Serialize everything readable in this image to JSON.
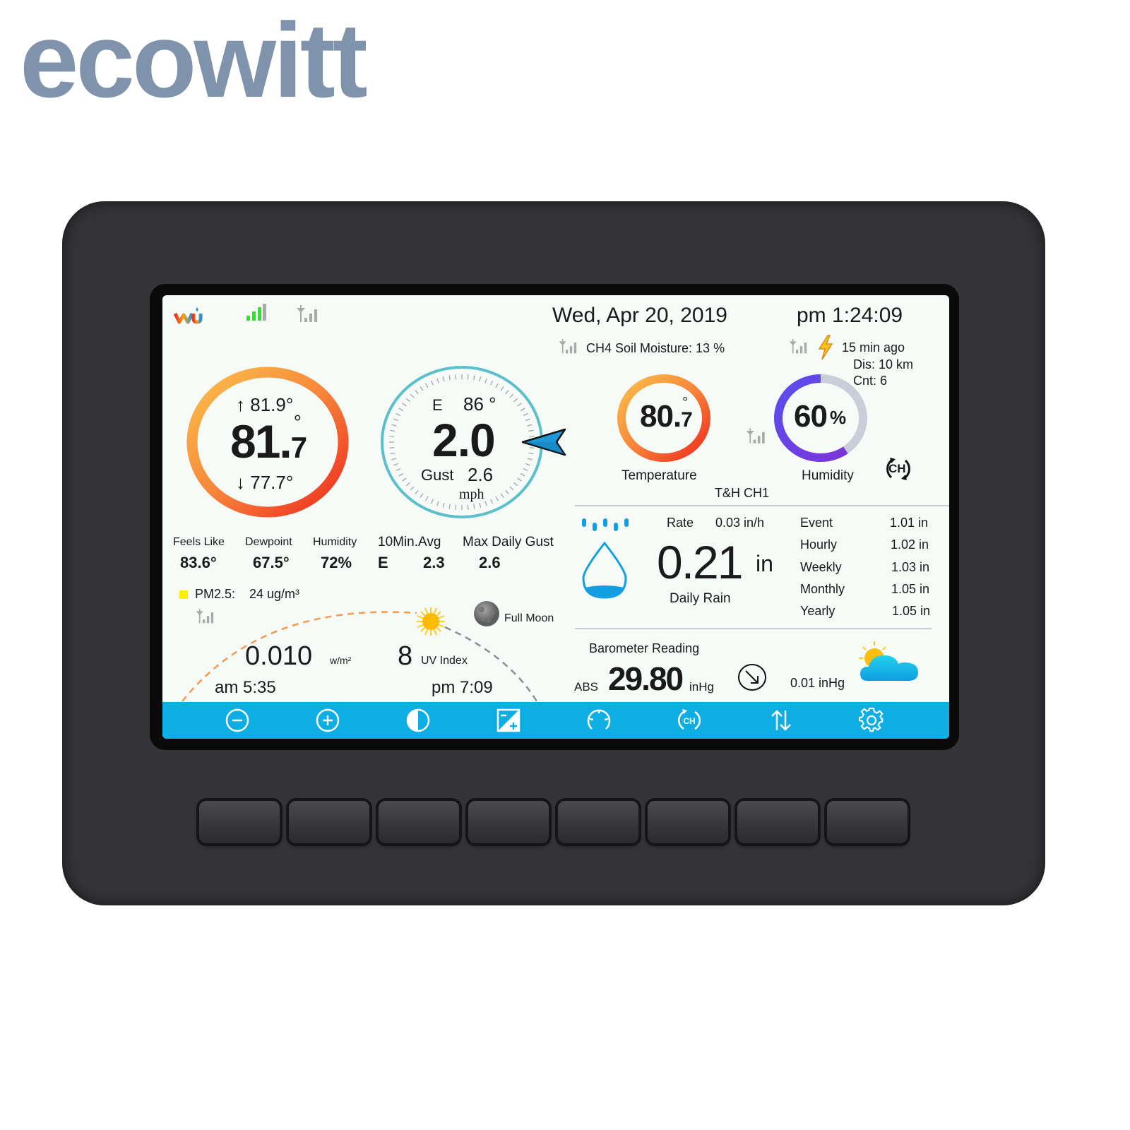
{
  "brand": {
    "logo_text": "ecowitt",
    "logo_color": "#8093ad"
  },
  "status_bar": {
    "icons": [
      "wunderground-logo-icon",
      "wifi-signal-icon",
      "rf-signal-icon"
    ],
    "date": "Wed,  Apr   20,  2019",
    "time": "pm  1:24:09"
  },
  "soil": {
    "label": "CH4 Soil Moisture: 13 %"
  },
  "lightning": {
    "ago": "15 min ago",
    "distance": "Dis: 10 km",
    "count": "Cnt:  6"
  },
  "outdoor_temp": {
    "high": "81.9°",
    "high_arrow": "↑",
    "current_int": "81.",
    "current_dec": "7",
    "degree": "°",
    "low": "77.7°",
    "low_arrow": "↓"
  },
  "wind": {
    "direction": "E",
    "degrees": "86 °",
    "speed": "2.0",
    "gust_label": "Gust",
    "gust": "2.6",
    "unit": "mph",
    "bearing_deg": 86
  },
  "th_channel": {
    "temp_int": "80.",
    "temp_dec": "7",
    "degree": "°",
    "temp_label": "Temperature",
    "humidity": "60",
    "humidity_unit": "%",
    "humidity_fraction": 0.6,
    "humidity_label": "Humidity",
    "channel_label": "T&H CH1",
    "ch_icon_text": "CH"
  },
  "stats": [
    {
      "label": "Feels Like",
      "value": "83.6°"
    },
    {
      "label": "Dewpoint",
      "value": "67.5°"
    },
    {
      "label": "Humidity",
      "value": "72%"
    }
  ],
  "wind_stats": {
    "avg_label": "10Min.Avg",
    "avg_dir": "E",
    "avg_value": "2.3",
    "max_label": "Max Daily Gust",
    "max_value": "2.6"
  },
  "pm25": {
    "label": "PM2.5:",
    "value": "24 ug/m³",
    "color": "#ffee00"
  },
  "sun": {
    "solar": "0.010",
    "solar_unit": "w/m²",
    "uv": "8",
    "uv_label": "UV Index",
    "sunrise": "am 5:35",
    "sunset": "pm 7:09",
    "moon_phase": "Full Moon"
  },
  "rain": {
    "rate_label": "Rate",
    "rate_value": "0.03 in/h",
    "daily": "0.21",
    "daily_unit": "in",
    "daily_label": "Daily Rain",
    "periods": [
      {
        "label": "Event",
        "value": "1.01 in"
      },
      {
        "label": "Hourly",
        "value": "1.02 in"
      },
      {
        "label": "Weekly",
        "value": "1.03 in"
      },
      {
        "label": "Monthly",
        "value": "1.05 in"
      },
      {
        "label": "Yearly",
        "value": "1.05 in"
      }
    ]
  },
  "barometer": {
    "title": "Barometer Reading",
    "mode": "ABS",
    "value": "29.80",
    "unit": "inHg",
    "change": "0.01 inHg",
    "forecast_icon": "partly-cloudy-icon"
  },
  "toolbar": {
    "color": "#0daee4",
    "buttons": [
      {
        "name": "zoom-out-button",
        "icon": "minus-circle-icon"
      },
      {
        "name": "zoom-in-button",
        "icon": "plus-circle-icon"
      },
      {
        "name": "contrast-button",
        "icon": "contrast-icon"
      },
      {
        "name": "calibration-button",
        "icon": "plus-minus-icon"
      },
      {
        "name": "wind-settings-button",
        "icon": "gauge-icon"
      },
      {
        "name": "channel-button",
        "icon": "channel-cycle-icon",
        "text": "CH"
      },
      {
        "name": "sort-button",
        "icon": "up-down-arrows-icon"
      },
      {
        "name": "settings-button",
        "icon": "gear-icon"
      }
    ]
  },
  "hardware_buttons": 8
}
